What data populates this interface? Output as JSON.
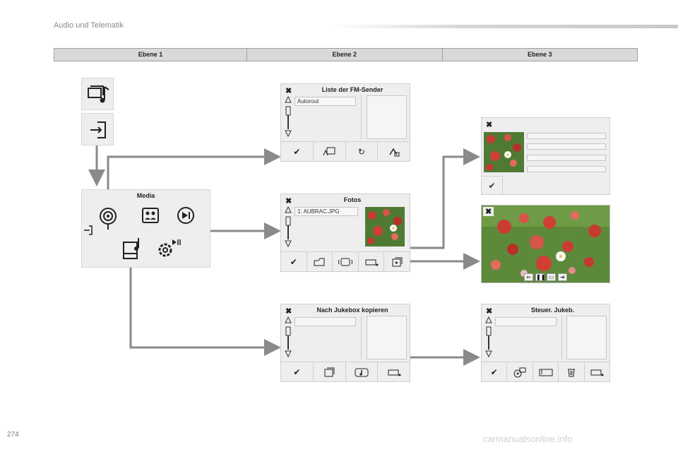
{
  "header": {
    "section_title": "Audio und Telematik"
  },
  "levels": [
    "Ebene 1",
    "Ebene 2",
    "Ebene 3"
  ],
  "media_panel": {
    "title": "Media"
  },
  "panels": {
    "fm": {
      "title": "Liste der FM-Sender",
      "field": "Autorout"
    },
    "fotos": {
      "title": "Fotos",
      "field": "1: AUBRAC.JPG"
    },
    "jukebox_copy": {
      "title": "Nach Jukebox kopieren"
    },
    "jukebox_ctrl": {
      "title": "Steuer. Jukeb."
    }
  },
  "icons": {
    "close": "close-icon",
    "check": "check-icon",
    "media_source": "media-source-icon",
    "exit": "exit-icon",
    "radio": "radio-icon",
    "photos": "photos-icon",
    "video": "video-icon",
    "jukebox": "jukebox-icon",
    "settings": "settings-icon"
  },
  "glyphs": {
    "close": "✖",
    "check": "✔",
    "refresh": "↻",
    "up": "△",
    "down": "▽",
    "prev": "⇐",
    "pause": "❚❚",
    "next": "➔"
  },
  "colors": {
    "panel_bg": "#eeeeee",
    "arrow": "#8a8a8a",
    "header_bar": "#d9d9d9"
  },
  "footer": {
    "page_number": "274",
    "watermark": "carmanualsonline.info"
  }
}
